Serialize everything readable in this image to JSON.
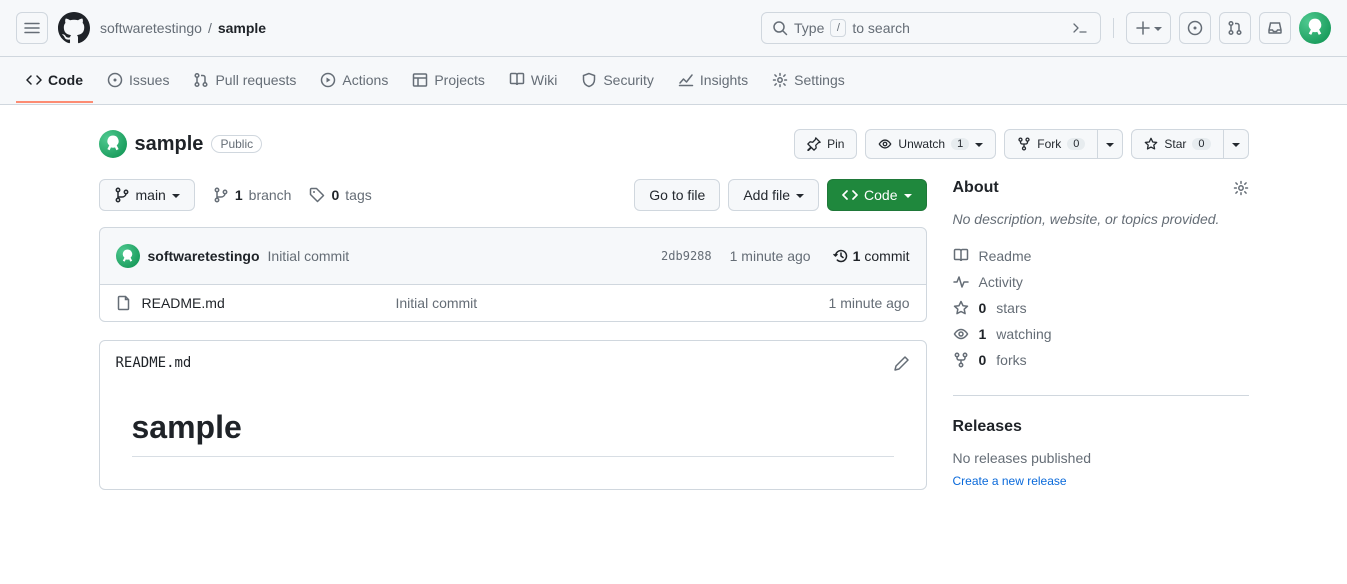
{
  "header": {
    "owner": "softwaretestingo",
    "repo": "sample",
    "search_prefix": "Type",
    "search_key": "/",
    "search_suffix": "to search"
  },
  "nav": {
    "code": "Code",
    "issues": "Issues",
    "pulls": "Pull requests",
    "actions": "Actions",
    "projects": "Projects",
    "wiki": "Wiki",
    "security": "Security",
    "insights": "Insights",
    "settings": "Settings"
  },
  "repo": {
    "name": "sample",
    "visibility": "Public",
    "pin": "Pin",
    "unwatch": "Unwatch",
    "unwatch_count": "1",
    "fork": "Fork",
    "fork_count": "0",
    "star": "Star",
    "star_count": "0"
  },
  "filebar": {
    "branch": "main",
    "branch_count": "1",
    "branch_label": "branch",
    "tag_count": "0",
    "tag_label": "tags",
    "goto": "Go to file",
    "addfile": "Add file",
    "code": "Code"
  },
  "commit": {
    "author": "softwaretestingo",
    "message": "Initial commit",
    "sha": "2db9288",
    "time": "1 minute ago",
    "commits_count": "1",
    "commits_label": "commit"
  },
  "files": [
    {
      "name": "README.md",
      "msg": "Initial commit",
      "time": "1 minute ago"
    }
  ],
  "readme": {
    "file": "README.md",
    "heading": "sample"
  },
  "about": {
    "title": "About",
    "no_desc": "No description, website, or topics provided.",
    "readme": "Readme",
    "activity": "Activity",
    "stars_count": "0",
    "stars_label": "stars",
    "watching_count": "1",
    "watching_label": "watching",
    "forks_count": "0",
    "forks_label": "forks"
  },
  "releases": {
    "title": "Releases",
    "none": "No releases published",
    "create": "Create a new release"
  }
}
